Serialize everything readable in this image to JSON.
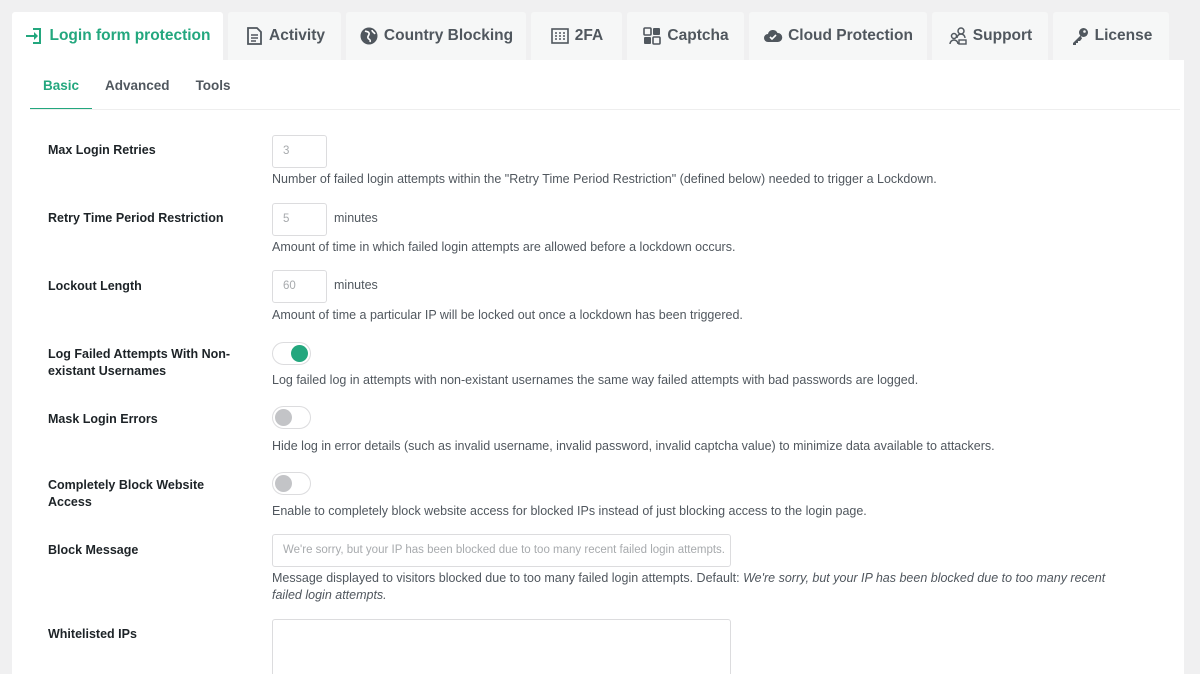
{
  "tabs": [
    {
      "label": "Login form protection",
      "icon": "login-icon",
      "active": true
    },
    {
      "label": "Activity",
      "icon": "document-icon"
    },
    {
      "label": "Country Blocking",
      "icon": "globe-icon"
    },
    {
      "label": "2FA",
      "icon": "keypad-icon"
    },
    {
      "label": "Captcha",
      "icon": "puzzle-icon"
    },
    {
      "label": "Cloud Protection",
      "icon": "cloud-icon"
    },
    {
      "label": "Support",
      "icon": "team-icon"
    },
    {
      "label": "License",
      "icon": "key-icon"
    }
  ],
  "subtabs": [
    {
      "label": "Basic",
      "active": true
    },
    {
      "label": "Advanced"
    },
    {
      "label": "Tools"
    }
  ],
  "settings": {
    "max_retries": {
      "label": "Max Login Retries",
      "value": "3",
      "description": "Number of failed login attempts within the \"Retry Time Period Restriction\" (defined below) needed to trigger a Lockdown."
    },
    "retry_period": {
      "label": "Retry Time Period Restriction",
      "value": "5",
      "unit": "minutes",
      "description": "Amount of time in which failed login attempts are allowed before a lockdown occurs."
    },
    "lockout_length": {
      "label": "Lockout Length",
      "value": "60",
      "unit": "minutes",
      "description": "Amount of time a particular IP will be locked out once a lockdown has been triggered."
    },
    "log_failed": {
      "label_line1": "Log Failed Attempts With Non-",
      "label_line2": "existant Usernames",
      "enabled": true,
      "description": "Log failed log in attempts with non-existant usernames the same way failed attempts with bad passwords are logged."
    },
    "mask_errors": {
      "label": "Mask Login Errors",
      "enabled": false,
      "description": "Hide log in error details (such as invalid username, invalid password, invalid captcha value) to minimize data available to attackers."
    },
    "block_website": {
      "label": "Completely Block Website Access",
      "enabled": false,
      "description": "Enable to completely block website access for blocked IPs instead of just blocking access to the login page."
    },
    "block_message": {
      "label": "Block Message",
      "value": "We're sorry, but your IP has been blocked due to too many recent failed login attempts.",
      "description_prefix": "Message displayed to visitors blocked due to too many failed login attempts. Default: ",
      "description_default_line1": "We're sorry, but your IP has been blocked due to too many recent",
      "description_default_line2": "failed login attempts."
    },
    "whitelist": {
      "label": "Whitelisted IPs"
    }
  },
  "colors": {
    "accent": "#23a77e",
    "toggle_off": "#c3c4c7"
  }
}
